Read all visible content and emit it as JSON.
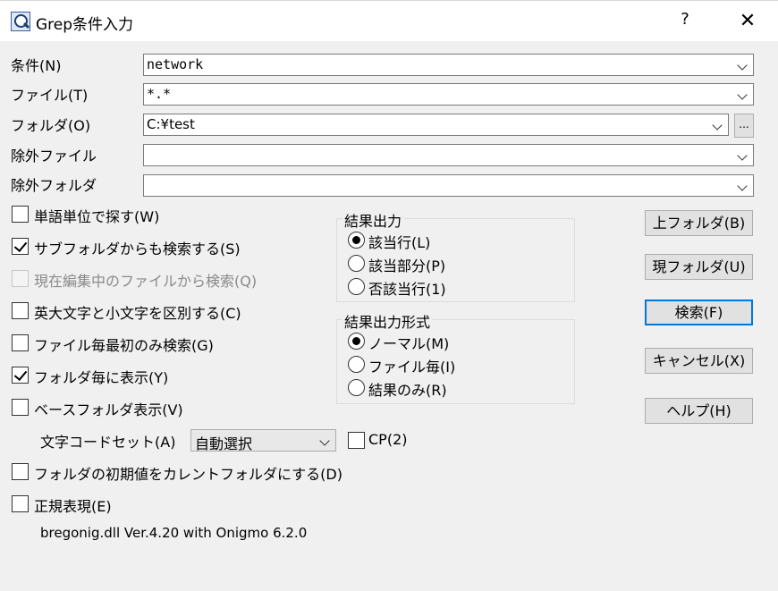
{
  "window": {
    "title": "Grep条件入力",
    "help_label": "?",
    "close_label": "✕"
  },
  "fields": {
    "condition": {
      "label": "条件(N)",
      "value": "network"
    },
    "file": {
      "label": "ファイル(T)",
      "value": "*.*"
    },
    "folder": {
      "label": "フォルダ(O)",
      "value": "C:¥test",
      "browse_label": "..."
    },
    "exclude_file": {
      "label": "除外ファイル",
      "value": ""
    },
    "exclude_folder": {
      "label": "除外フォルダ",
      "value": ""
    }
  },
  "checkboxes": [
    {
      "label": "単語単位で探す(W)",
      "checked": false,
      "disabled": false
    },
    {
      "label": "サブフォルダからも検索する(S)",
      "checked": true,
      "disabled": false
    },
    {
      "label": "現在編集中のファイルから検索(Q)",
      "checked": false,
      "disabled": true
    },
    {
      "label": "英大文字と小文字を区別する(C)",
      "checked": false,
      "disabled": false
    },
    {
      "label": "ファイル毎最初のみ検索(G)",
      "checked": false,
      "disabled": false
    },
    {
      "label": "フォルダ毎に表示(Y)",
      "checked": true,
      "disabled": false
    },
    {
      "label": "ベースフォルダ表示(V)",
      "checked": false,
      "disabled": false
    },
    {
      "label": "フォルダの初期値をカレントフォルダにする(D)",
      "checked": false,
      "disabled": false
    },
    {
      "label": "正規表現(E)",
      "checked": false,
      "disabled": false
    }
  ],
  "charset": {
    "label": "文字コードセット(A)",
    "value": "自動選択",
    "cp_label": "CP(2)",
    "cp_checked": false
  },
  "result_output": {
    "title": "結果出力",
    "options": [
      {
        "label": "該当行(L)",
        "selected": true
      },
      {
        "label": "該当部分(P)",
        "selected": false
      },
      {
        "label": "否該当行(1)",
        "selected": false
      }
    ]
  },
  "result_format": {
    "title": "結果出力形式",
    "options": [
      {
        "label": "ノーマル(M)",
        "selected": true
      },
      {
        "label": "ファイル毎(I)",
        "selected": false
      },
      {
        "label": "結果のみ(R)",
        "selected": false
      }
    ]
  },
  "buttons": {
    "upper_folder": "上フォルダ(B)",
    "current_folder": "現フォルダ(U)",
    "search": "検索(F)",
    "cancel": "キャンセル(X)",
    "help": "ヘルプ(H)"
  },
  "footer": "bregonig.dll Ver.4.20 with Onigmo 6.2.0"
}
